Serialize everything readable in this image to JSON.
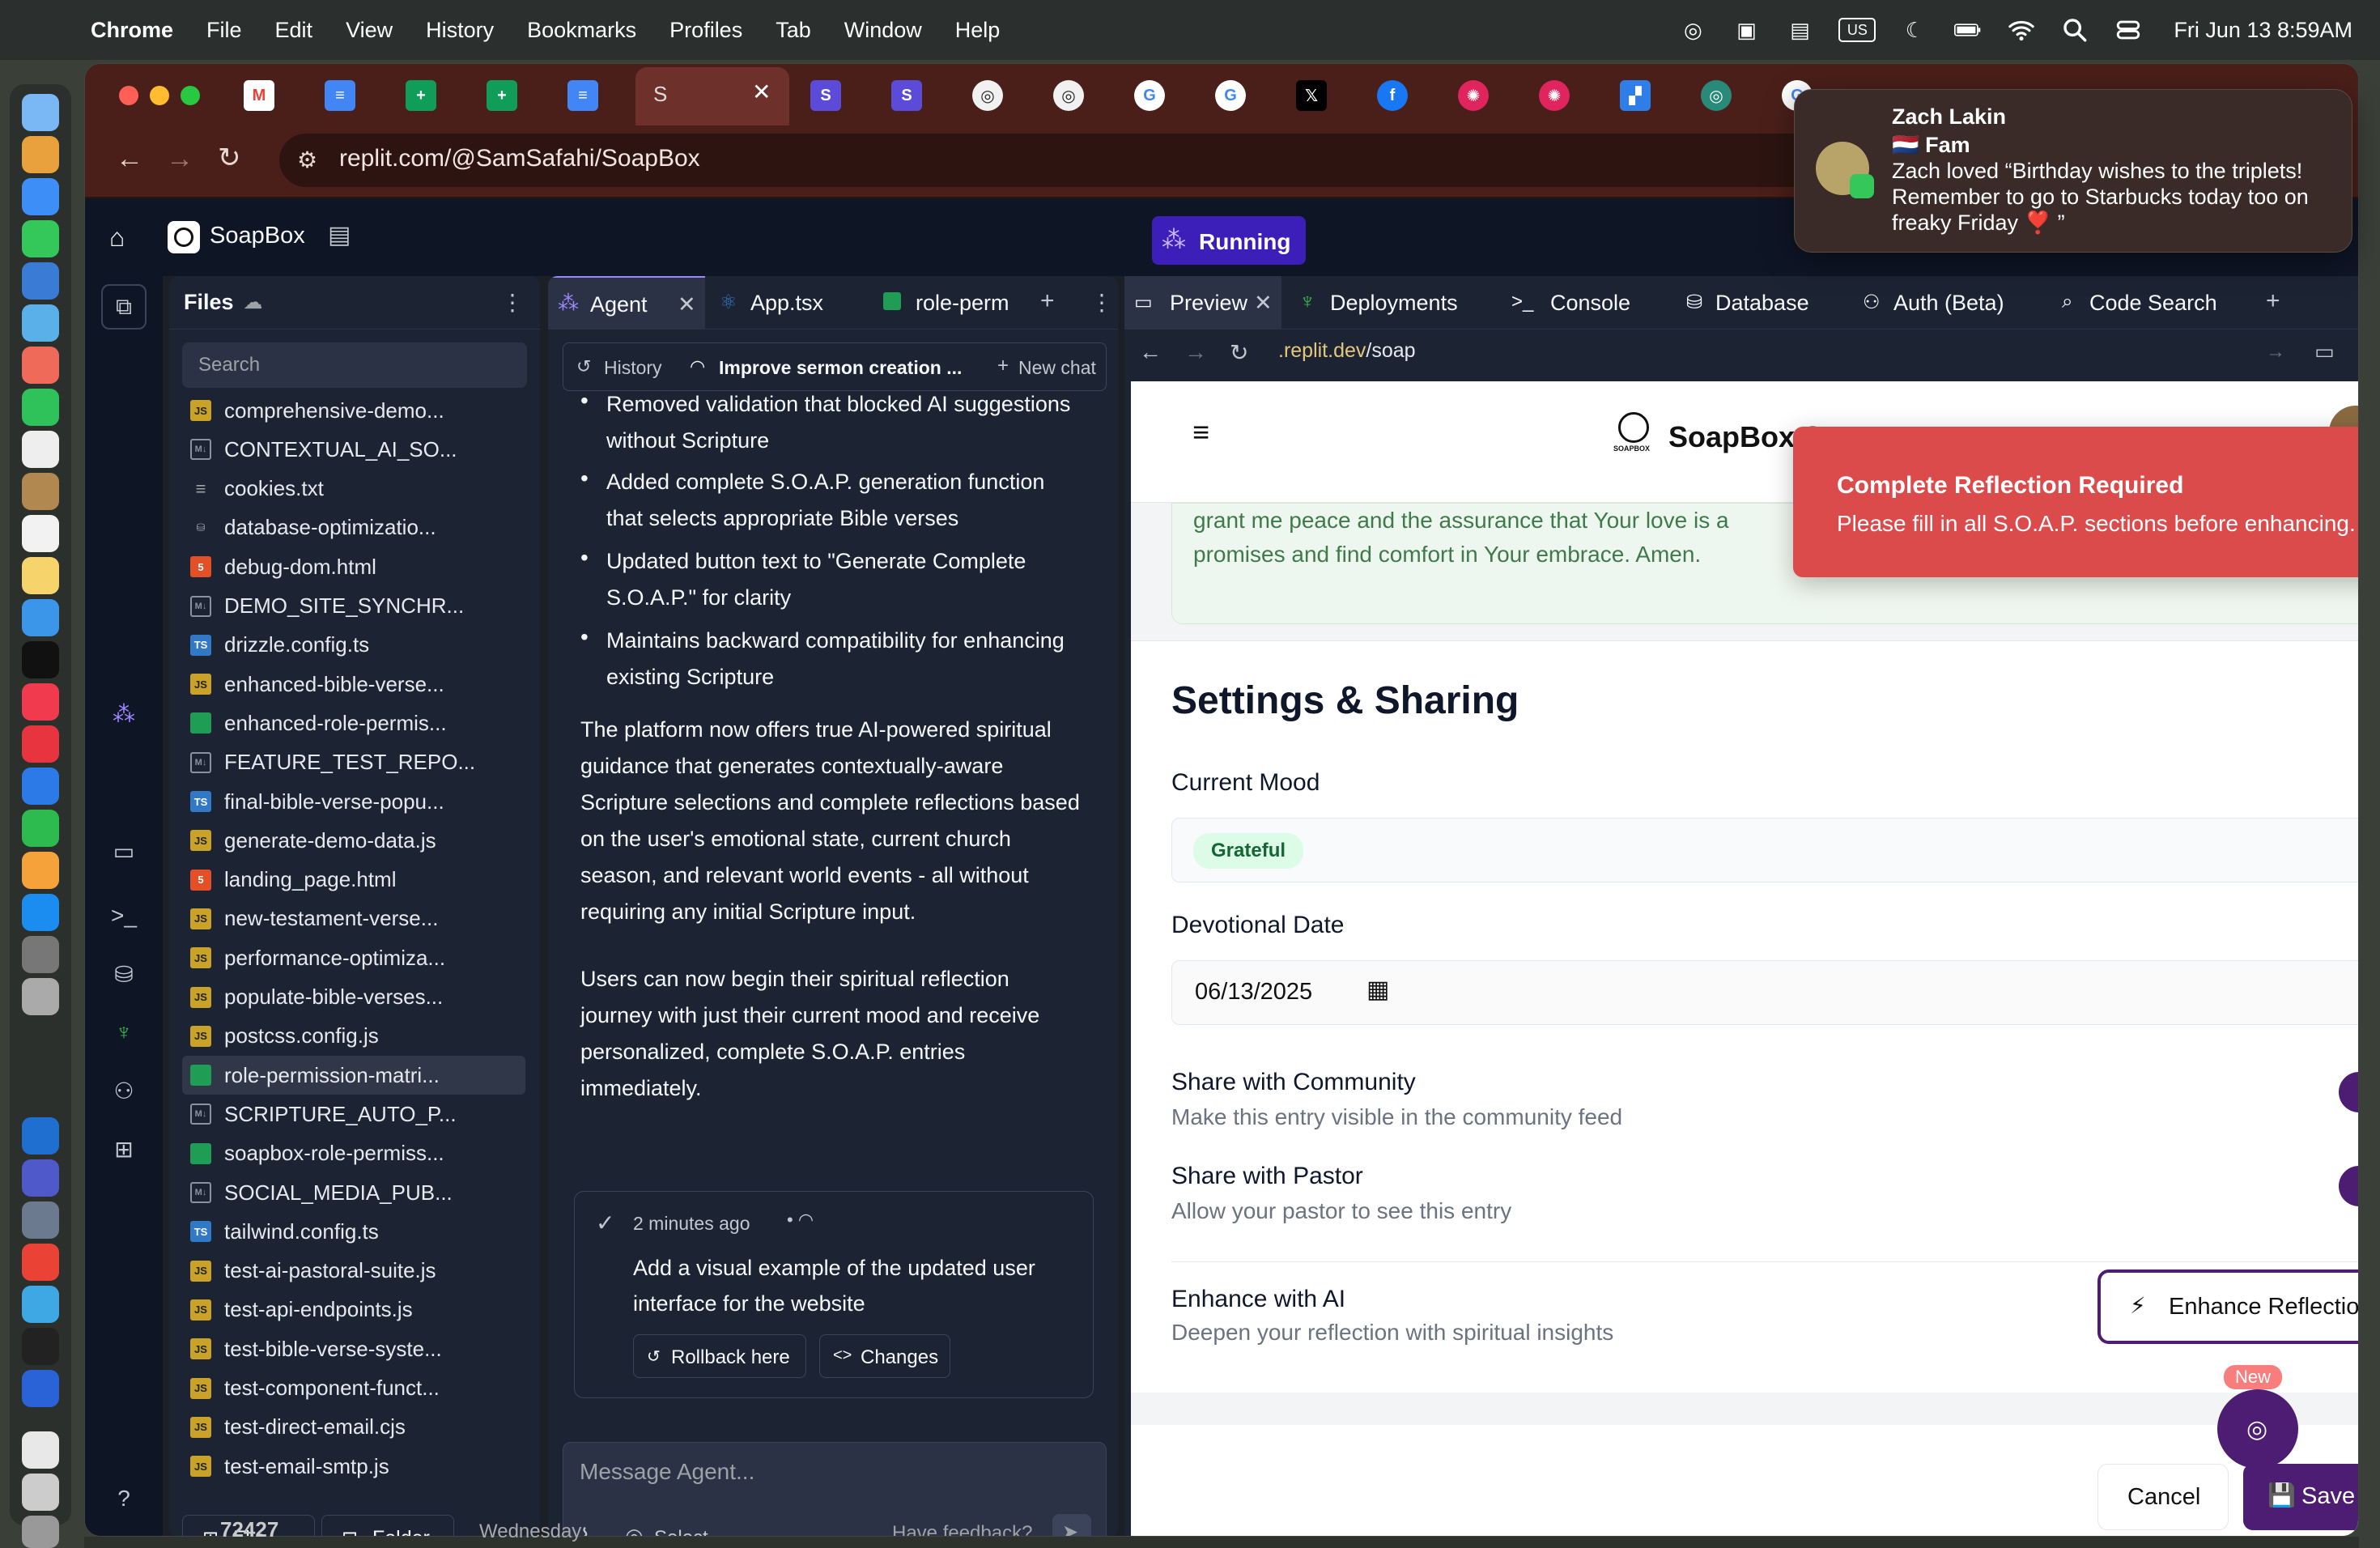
{
  "menubar": {
    "items": [
      "Chrome",
      "File",
      "Edit",
      "View",
      "History",
      "Bookmarks",
      "Profiles",
      "Tab",
      "Window",
      "Help"
    ],
    "clock": "Fri Jun 13  8:59AM",
    "us_label": "US"
  },
  "browser": {
    "url": "replit.com/@SamSafahi/SoapBox"
  },
  "notification": {
    "sender": "Zach Lakin",
    "group": "🇳🇱 Fam",
    "message": "Zach loved “Birthday wishes to the triplets! Remember to go to Starbucks today too on freaky Friday ❣️ ”"
  },
  "replit": {
    "project": "SoapBox",
    "run_status": "Running"
  },
  "files": {
    "title": "Files",
    "search_placeholder": "Search",
    "items": [
      {
        "name": "comprehensive-demo...",
        "type": "js"
      },
      {
        "name": "CONTEXTUAL_AI_SO...",
        "type": "md"
      },
      {
        "name": "cookies.txt",
        "type": "txt"
      },
      {
        "name": "database-optimizatio...",
        "type": "db"
      },
      {
        "name": "debug-dom.html",
        "type": "html"
      },
      {
        "name": "DEMO_SITE_SYNCHR...",
        "type": "md"
      },
      {
        "name": "drizzle.config.ts",
        "type": "ts"
      },
      {
        "name": "enhanced-bible-verse...",
        "type": "js"
      },
      {
        "name": "enhanced-role-permis...",
        "type": "csv"
      },
      {
        "name": "FEATURE_TEST_REPO...",
        "type": "md"
      },
      {
        "name": "final-bible-verse-popu...",
        "type": "ts"
      },
      {
        "name": "generate-demo-data.js",
        "type": "js"
      },
      {
        "name": "landing_page.html",
        "type": "html"
      },
      {
        "name": "new-testament-verse...",
        "type": "js"
      },
      {
        "name": "performance-optimiza...",
        "type": "js"
      },
      {
        "name": "populate-bible-verses...",
        "type": "js"
      },
      {
        "name": "postcss.config.js",
        "type": "js"
      },
      {
        "name": "role-permission-matri...",
        "type": "csv"
      },
      {
        "name": "SCRIPTURE_AUTO_P...",
        "type": "md"
      },
      {
        "name": "soapbox-role-permiss...",
        "type": "csv"
      },
      {
        "name": "SOCIAL_MEDIA_PUB...",
        "type": "md"
      },
      {
        "name": "tailwind.config.ts",
        "type": "ts"
      },
      {
        "name": "test-ai-pastoral-suite.js",
        "type": "js"
      },
      {
        "name": "test-api-endpoints.js",
        "type": "js"
      },
      {
        "name": "test-bible-verse-syste...",
        "type": "js"
      },
      {
        "name": "test-component-funct...",
        "type": "js"
      },
      {
        "name": "test-direct-email.cjs",
        "type": "js"
      },
      {
        "name": "test-email-smtp.js",
        "type": "js"
      }
    ],
    "file_button": "File",
    "folder_button": "Folder"
  },
  "agent_panel": {
    "tabs": [
      "Agent",
      "App.tsx",
      "role-perm"
    ],
    "history_label": "History",
    "thread_title": "Improve sermon creation ...",
    "new_chat": "New chat",
    "bullets": [
      "Removed validation that blocked AI suggestions without Scripture",
      "Added complete S.O.A.P. generation function that selects appropriate Bible verses",
      "Updated button text to \"Generate Complete S.O.A.P.\" for clarity",
      "Maintains backward compatibility for enhancing existing Scripture"
    ],
    "paragraph1": "The platform now offers true AI-powered spiritual guidance that generates contextually-aware Scripture selections and complete reflections based on the user's emotional state, current church season, and relevant world events - all without requiring any initial Scripture input.",
    "paragraph2": "Users can now begin their spiritual reflection journey with just their current mood and receive personalized, complete S.O.A.P. entries immediately.",
    "checkpoint_time": "2 minutes ago",
    "checkpoint_text": "Add a visual example of the updated user interface for the website",
    "rollback": "Rollback here",
    "changes": "Changes",
    "message_placeholder": "Message Agent...",
    "select": "Select",
    "feedback": "Have feedback?"
  },
  "preview_panel": {
    "tabs": [
      "Preview",
      "Deployments",
      "Console",
      "Database",
      "Auth (Beta)",
      "Code Search"
    ],
    "url_prefix": ".replit.dev",
    "url_path": "/soap",
    "badge_count": "1"
  },
  "site": {
    "logo_text": "SOAPBOX",
    "title": "SoapBox Super App",
    "prayer_line1": "grant me peace and the assurance that Your love is a",
    "prayer_line2": "promises and find comfort in Your embrace. Amen.",
    "toast_title": "Complete Reflection Required",
    "toast_message": "Please fill in all S.O.A.P. sections before enhancing.",
    "settings_heading": "Settings & Sharing",
    "mood_label": "Current Mood",
    "mood_value": "Grateful",
    "date_label": "Devotional Date",
    "date_value": "06/13/2025",
    "share_community": "Share with Community",
    "share_community_desc": "Make this entry visible in the community feed",
    "share_pastor": "Share with Pastor",
    "share_pastor_desc": "Allow your pastor to see this entry",
    "enhance_label": "Enhance with AI",
    "enhance_desc": "Deepen your reflection with spiritual insights",
    "enhance_button": "Enhance Reflection",
    "new_badge": "New",
    "cancel": "Cancel",
    "save": "Save Entry"
  },
  "desktop_bottom": {
    "number": "72427",
    "day": "Wednesday"
  }
}
